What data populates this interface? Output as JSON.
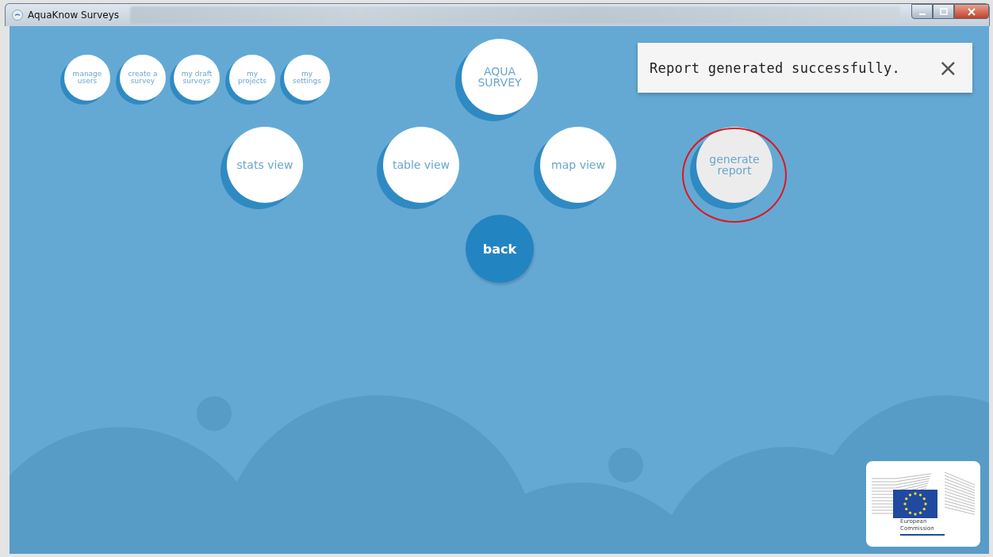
{
  "window": {
    "title": "AquaKnow Surveys"
  },
  "nav_buttons": [
    {
      "label": "manage users"
    },
    {
      "label": "create a survey"
    },
    {
      "label": "my draft surveys"
    },
    {
      "label": "my projects"
    },
    {
      "label": "my settings"
    }
  ],
  "logo": {
    "text": "AQUA SURVEY"
  },
  "views": [
    {
      "label": "stats view",
      "selected": false,
      "annotated": false
    },
    {
      "label": "table view",
      "selected": false,
      "annotated": false
    },
    {
      "label": "map view",
      "selected": false,
      "annotated": false
    },
    {
      "label": "generate report",
      "selected": true,
      "annotated": true
    }
  ],
  "back_button": {
    "label": "back"
  },
  "toast": {
    "message": "Report generated successfully.",
    "close": "×"
  },
  "footer_logo": {
    "text": "European Commission"
  }
}
